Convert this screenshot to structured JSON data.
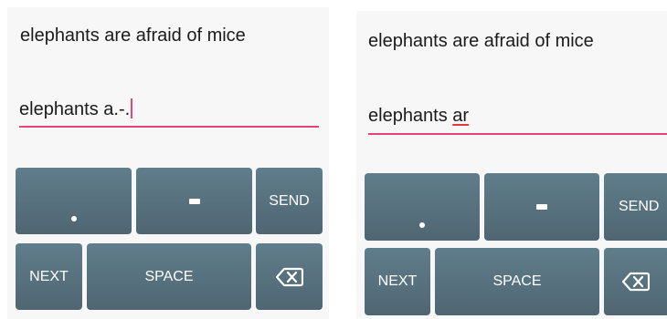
{
  "left": {
    "prompt": "elephants are afraid of mice",
    "typed": "elephants a.-.",
    "keys": {
      "send": "SEND",
      "next": "NEXT",
      "space": "SPACE",
      "period_icon": "period-dot-icon",
      "dash_icon": "dash-icon",
      "backspace_icon": "backspace-icon"
    }
  },
  "right": {
    "prompt": "elephants are afraid of mice",
    "typed_prefix": "elephants ",
    "typed_word": "ar",
    "keys": {
      "send": "SEND",
      "next": "NEXT",
      "space": "SPACE",
      "period_icon": "period-dot-icon",
      "dash_icon": "dash-icon",
      "backspace_icon": "backspace-icon"
    }
  },
  "colors": {
    "key_top": "#607d8b",
    "key_bottom": "#4f6672",
    "underline": "#e8427a",
    "spell_error": "#e53935"
  }
}
